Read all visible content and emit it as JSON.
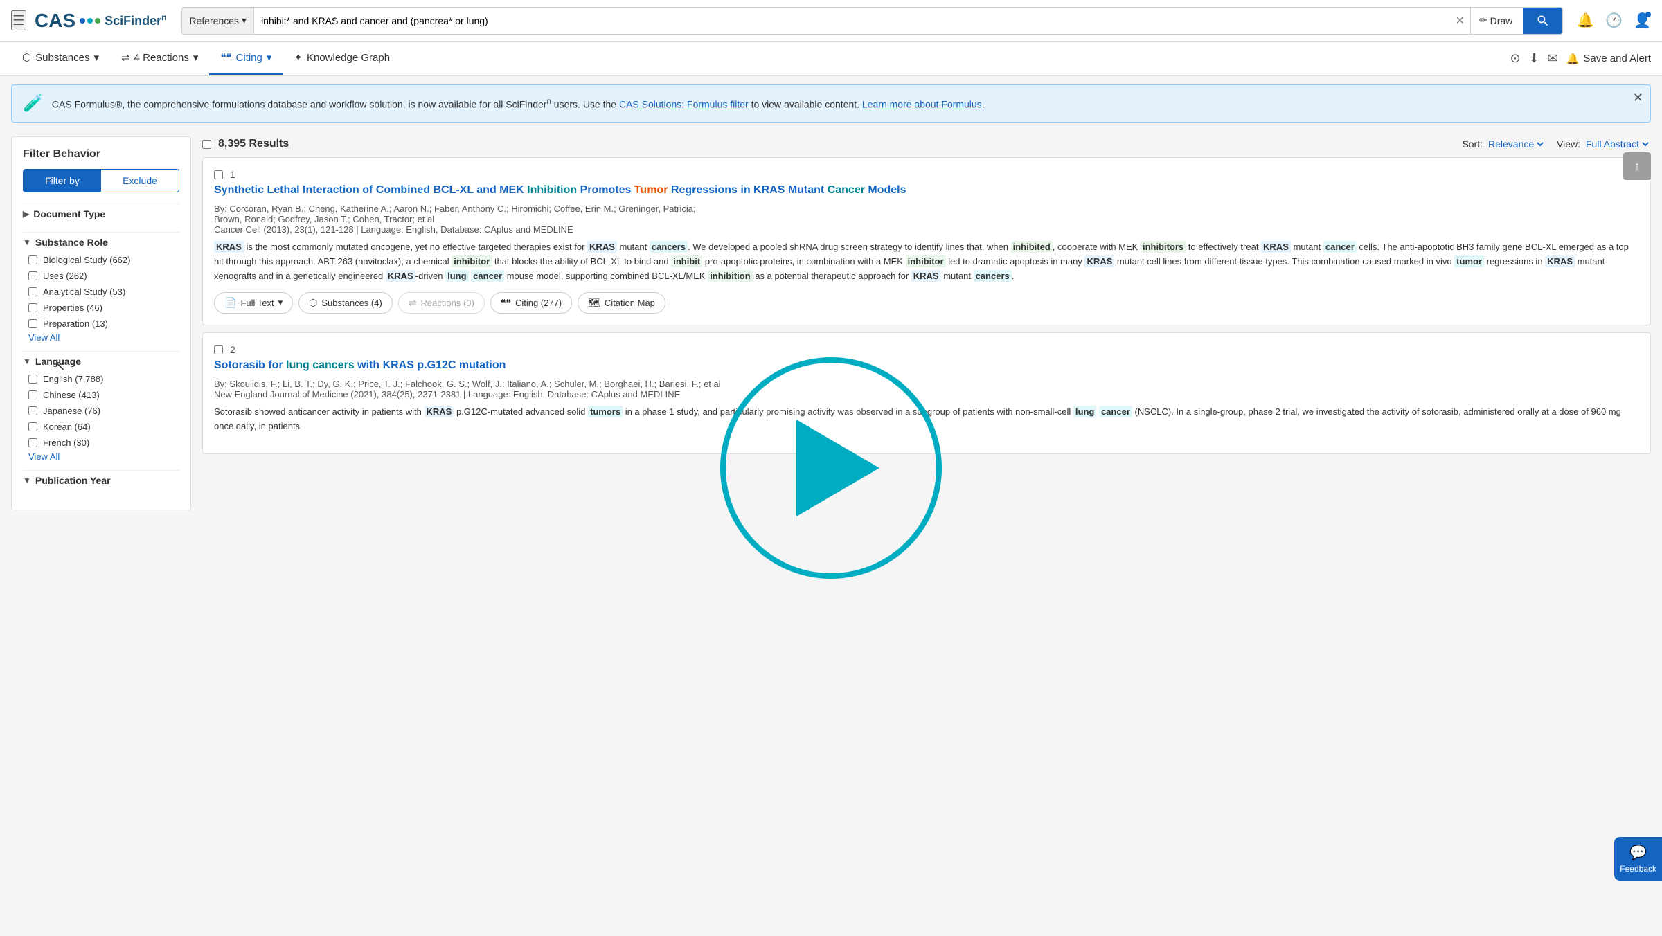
{
  "header": {
    "menu_icon": "☰",
    "logo_cas": "CAS",
    "logo_scifinder": "SciFinder",
    "search_type": "References",
    "search_query": "inhibit* and KRAS and cancer and (pancrea* or lung)",
    "draw_label": "Draw",
    "search_icon": "🔍",
    "bell_icon": "🔔",
    "history_icon": "🕐",
    "user_icon": "👤"
  },
  "subnav": {
    "substances_label": "Substances",
    "reactions_label": "4 Reactions",
    "citing_label": "Citing",
    "knowledge_graph_label": "Knowledge Graph",
    "save_alert_label": "Save and Alert",
    "download_icon": "⬇",
    "email_icon": "✉",
    "bell_icon": "🔔",
    "compare_icon": "⊙"
  },
  "banner": {
    "icon": "🧪",
    "text": "CAS Formulus®, the comprehensive formulations database and workflow solution, is now available for all SciFinder",
    "superscript": "n",
    "text2": " users. Use the ",
    "link1": "CAS Solutions: Formulus filter",
    "text3": " to view available content. ",
    "link2": "Learn more about Formulus",
    "text4": ".",
    "close_icon": "✕"
  },
  "sidebar": {
    "title": "Filter Behavior",
    "filter_by_label": "Filter by",
    "exclude_label": "Exclude",
    "document_type_label": "Document Type",
    "substance_role_label": "Substance Role",
    "substance_role_items": [
      {
        "label": "Biological Study",
        "count": "(662)"
      },
      {
        "label": "Uses",
        "count": "(262)"
      },
      {
        "label": "Analytical Study",
        "count": "(53)"
      },
      {
        "label": "Properties",
        "count": "(46)"
      },
      {
        "label": "Preparation",
        "count": "(13)"
      }
    ],
    "view_all_label": "View All",
    "language_label": "Language",
    "language_items": [
      {
        "label": "English",
        "count": "(7,788)"
      },
      {
        "label": "Chinese",
        "count": "(413)"
      },
      {
        "label": "Japanese",
        "count": "(76)"
      },
      {
        "label": "Korean",
        "count": "(64)"
      },
      {
        "label": "French",
        "count": "(30)"
      }
    ],
    "publication_year_label": "Publication Year"
  },
  "results": {
    "count": "8,395 Results",
    "sort_label": "Sort:",
    "sort_value": "Relevance",
    "view_label": "View:",
    "view_value": "Full Abstract"
  },
  "articles": [
    {
      "number": "1",
      "title": "Synthetic Lethal Interaction of Combined BCL-XL and MEK Inhibition Promotes Tumor Regressions in KRAS Mutant Cancer Models",
      "authors": "By: Corcoran, Ryan B.; Cheng, Katherine A.; Aaron N.; Faber, Anthony C.; Hiromichi; Coffee, Erin M.; Greninger, Patricia; Brown, Ronald; Godfrey, Jason T.; Cohen, Tractor; et al",
      "journal": "Cancer Cell (2013), 23(1), 121-128 | Language: English, Database: CAplus and MEDLINE",
      "abstract": "KRAS is the most commonly mutated oncogene, yet no effective targeted therapies exist for KRAS mutant cancers. We developed a pooled shRNA drug screen strategy to identify lines that, when inhibited, cooperate with MEK inhibitors to effectively treat KRAS mutant cancer cells. The anti-apoptotic BH3 family gene BCL-XL emerged as a top hit through this approach. ABT-263 (navitoclax), a chemical inhibitor that blocks the ability of BCL-XL to bind and inhibit pro-apoptotic proteins, in combination with a MEK inhibitor led to dramatic apoptosis in many KRAS mutant cell lines from different tissue types. This combination caused marked in vivo tumor regressions in KRAS mutant xenografts and in a genetically engineered KRAS-driven lung cancer mouse model, supporting combined BCL-XL/MEK inhibition as a potential therapeutic approach for KRAS mutant cancers.",
      "full_text_label": "Full Text",
      "substances_label": "Substances (4)",
      "reactions_label": "Reactions (0)",
      "citing_label": "Citing (277)",
      "citation_map_label": "Citation Map"
    },
    {
      "number": "2",
      "title": "Sotorasib for lung cancers with KRAS p.G12C mutation",
      "authors": "By: Skoulidis, F.; Li, B. T.; Dy, G. K.; Price, T. J.; Falchook, G. S.; Wolf, J.; Italiano, A.; Schuler, M.; Borghaei, H.; Barlesi, F.; et al",
      "journal": "New England Journal of Medicine (2021), 384(25), 2371-2381 | Language: English, Database: CAplus and MEDLINE",
      "abstract": "Sotorasib showed anticancer activity in patients with KRAS p.G12C-mutated advanced solid tumors in a phase 1 study, and particularly promising activity was observed in a subgroup of patients with non-small-cell lung cancer (NSCLC). In a single-group, phase 2 trial, we investigated the activity of sotorasib, administered orally at a dose of 960 mg once daily, in patients"
    }
  ],
  "feedback": {
    "icon": "💬",
    "label": "Feedback"
  },
  "scroll_top": {
    "icon": "↑"
  }
}
